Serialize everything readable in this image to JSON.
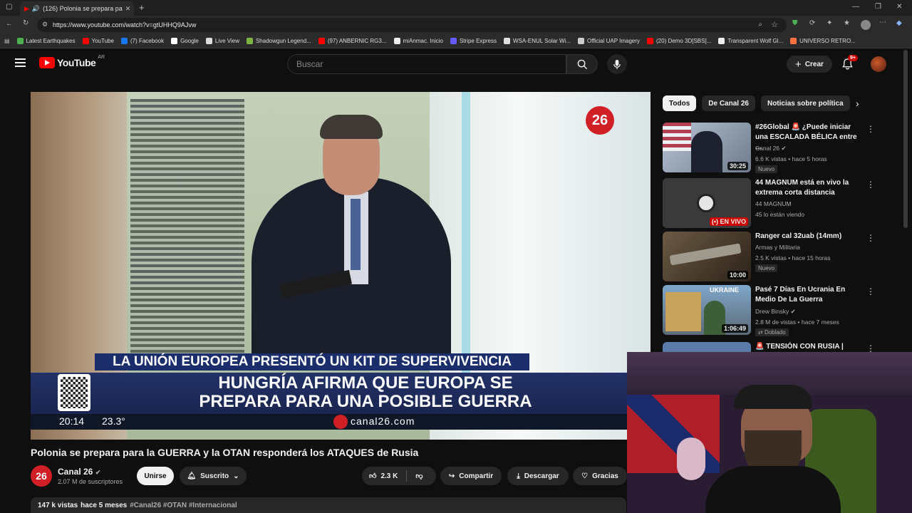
{
  "browser": {
    "tab_title": "(126) Polonia se prepara pa",
    "url": "https://www.youtube.com/watch?v=gtUHHQ9AJvw",
    "bookmarks": [
      {
        "label": "Latest Earthquakes",
        "color": "#4caf50"
      },
      {
        "label": "YouTube",
        "color": "#ff0000"
      },
      {
        "label": "(7) Facebook",
        "color": "#1877f2"
      },
      {
        "label": "Google",
        "color": "#ffffff"
      },
      {
        "label": "Live View",
        "color": "#dddddd"
      },
      {
        "label": "Shadowgun Legend...",
        "color": "#7cb342"
      },
      {
        "label": "(97) ANBERNIC RG3...",
        "color": "#ff0000"
      },
      {
        "label": "miAnmac. Inicio",
        "color": "#eeeeee"
      },
      {
        "label": "Stripe Express",
        "color": "#635bff"
      },
      {
        "label": "WSA-ENUL Solar Wi...",
        "color": "#e0e0e0"
      },
      {
        "label": "Official UAP Imagery",
        "color": "#cccccc"
      },
      {
        "label": "(20) Demo 3D[SBS]...",
        "color": "#ff0000"
      },
      {
        "label": "Transparent Wolf Gl...",
        "color": "#eeeeee"
      },
      {
        "label": "UNIVERSO RETRO...",
        "color": "#ff7043"
      }
    ]
  },
  "header": {
    "logo_text": "YouTube",
    "region": "AR",
    "search_placeholder": "Buscar",
    "create_label": "Crear",
    "notif_count": "9+"
  },
  "player": {
    "channel_logo": "26",
    "banner_top": "LA UNIÓN EUROPEA PRESENTÓ UN KIT DE SUPERVIVENCIA",
    "headline_line1": "HUNGRÍA AFIRMA QUE EUROPA SE",
    "headline_line2": "PREPARA PARA UNA POSIBLE GUERRA",
    "clock": "20:14",
    "temperature": "23.3°",
    "site": "canal26.com"
  },
  "video": {
    "title": "Polonia se prepara para la GUERRA y la OTAN responderá los ATAQUES de Rusia",
    "channel_name": "Canal 26",
    "subscribers": "2.07 M de suscriptores",
    "join_label": "Unirse",
    "subscribed_label": "Suscrito",
    "likes": "2.3 K",
    "share_label": "Compartir",
    "download_label": "Descargar",
    "thanks_label": "Gracias",
    "views": "147 k vistas",
    "age": "hace 5 meses",
    "tags": "#Canal26 #OTAN #Internacional"
  },
  "chips": [
    "Todos",
    "De Canal 26",
    "Noticias sobre política"
  ],
  "recommendations": [
    {
      "title": "#26Global 🚨 ¿Puede iniciar una ESCALADA BÉLICA entre ...",
      "channel": "Canal 26",
      "verified": true,
      "meta": "6.6 K vistas • hace 5 horas",
      "duration": "30:25",
      "badge": "Nuevo"
    },
    {
      "title": "44 MAGNUM está en vivo la extrema corta distancia",
      "channel": "44 MAGNUM",
      "verified": false,
      "meta": "45 lo están viendo",
      "duration": "EN VIVO",
      "badge": ""
    },
    {
      "title": "Ranger cal 32uab (14mm)",
      "channel": "Armas y Militaria",
      "verified": false,
      "meta": "2.5 K vistas • hace 15 horas",
      "duration": "10:00",
      "badge": "Nuevo"
    },
    {
      "title": "Pasé 7 Días En Ucrania En Medio De La Guerra",
      "channel": "Drew Binsky",
      "verified": true,
      "meta": "2.8 M de vistas • hace 7 meses",
      "duration": "1:06:49",
      "badge": "Doblado",
      "thumb_label": "UKRAINE"
    },
    {
      "title": "🚨 TENSIÓN CON RUSIA |",
      "channel": "",
      "verified": false,
      "meta": "",
      "duration": "",
      "badge": ""
    }
  ],
  "colors": {
    "accent": "#ff0000",
    "bg": "#0f0f0f",
    "surface": "#272727",
    "navy_banner": "#1e2a52"
  }
}
